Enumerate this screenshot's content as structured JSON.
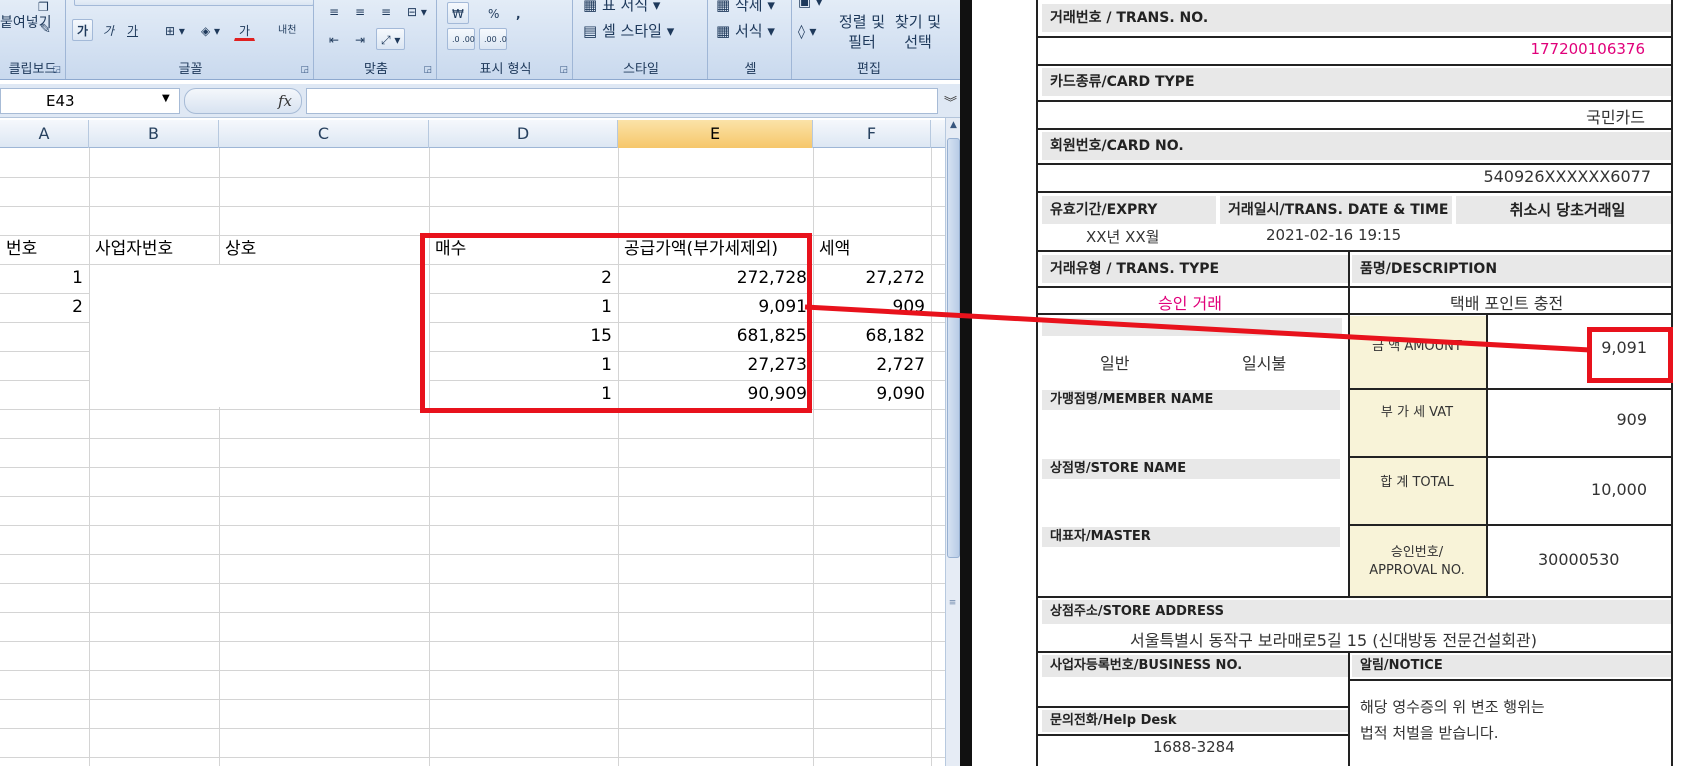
{
  "ribbon": {
    "clipboard": {
      "label": "클립보드",
      "paste_label": "붙여넣기"
    },
    "font": {
      "label": "글꼴",
      "bold": "가",
      "italic": "가",
      "underline": "가",
      "font_color": "가",
      "phonetic": "내천"
    },
    "alignment": {
      "label": "맞춤"
    },
    "number": {
      "label": "표시 형식",
      "currency": "₩",
      "percent": "%",
      "comma": ",",
      "inc_decimal": ".0 .00",
      "dec_decimal": ".00 .0"
    },
    "styles": {
      "label": "스타일",
      "table_format": "표 서식",
      "cell_style": "셀 스타일"
    },
    "cells": {
      "label": "셀",
      "delete": "삭제",
      "format": "서식"
    },
    "editing": {
      "label": "편집",
      "sort_filter": "정렬 및 필터",
      "find_select": "찾기 및 선택"
    }
  },
  "formula_bar": {
    "name_box": "E43",
    "fx": "fx",
    "value": ""
  },
  "columns": [
    "A",
    "B",
    "C",
    "D",
    "E",
    "F"
  ],
  "active_column": "E",
  "sheet": {
    "headers": {
      "a": "번호",
      "b": "사업자번호",
      "c": "상호",
      "d": "매수",
      "e": "공급가액(부가세제외)",
      "f": "세액"
    },
    "rows": [
      {
        "a": "1",
        "d": "2",
        "e": "272,728",
        "f": "27,272"
      },
      {
        "a": "2",
        "d": "1",
        "e": "9,091",
        "f": "909"
      },
      {
        "a": "",
        "d": "15",
        "e": "681,825",
        "f": "68,182"
      },
      {
        "a": "",
        "d": "1",
        "e": "27,273",
        "f": "2,727"
      },
      {
        "a": "",
        "d": "1",
        "e": "90,909",
        "f": "9,090"
      }
    ]
  },
  "receipt": {
    "trans_no_label": "거래번호 / TRANS. NO.",
    "trans_no": "177200106376",
    "card_type_label": "카드종류/CARD TYPE",
    "card_type": "국민카드",
    "card_no_label": "회원번호/CARD NO.",
    "card_no": "540926XXXXXX6077",
    "expiry_label": "유효기간/EXPRY",
    "expiry": "XX년   XX월",
    "trans_date_label": "거래일시/TRANS. DATE & TIME",
    "trans_date": "2021-02-16   19:15",
    "cancel_label": "취소시 당초거래일",
    "trans_type_label": "거래유형 / TRANS. TYPE",
    "trans_type": "승인 거래",
    "description_label": "품명/DESCRIPTION",
    "description": "택배 포인트 충전",
    "installment_left": "일반",
    "installment_right": "일시불",
    "amount_label": "금 액 AMOUNT",
    "amount": "9,091",
    "vat_label": "부 가 세 VAT",
    "vat": "909",
    "total_label": "합    계 TOTAL",
    "total": "10,000",
    "approval_label": "승인번호/ APPROVAL NO.",
    "approval": "30000530",
    "member_name_label": "가맹점명/MEMBER NAME",
    "store_name_label": "상점명/STORE NAME",
    "master_label": "대표자/MASTER",
    "store_address_label": "상점주소/STORE ADDRESS",
    "store_address": "서울특별시 동작구 보라매로5길 15 (신대방동 전문건설회관)",
    "business_no_label": "사업자등록번호/BUSINESS NO.",
    "notice_label": "알림/NOTICE",
    "notice_line1": "해당 영수증의 위 변조 행위는",
    "notice_line2": "법적 처벌을 받습니다.",
    "helpdesk_label": "문의전화/Help Desk",
    "helpdesk": "1688-3284"
  },
  "colors": {
    "highlight": "#e8121c",
    "trans_no": "#e0007a",
    "trans_type": "#e0007a",
    "active_header": "#f6c76a"
  }
}
